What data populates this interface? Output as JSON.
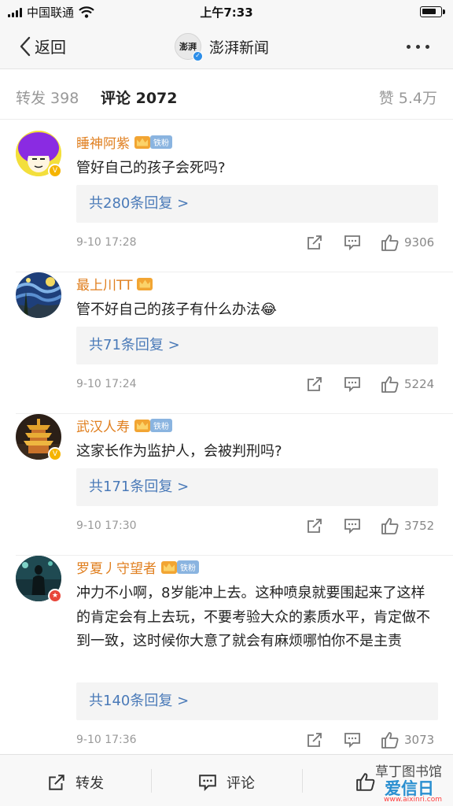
{
  "status_bar": {
    "carrier": "中国联通",
    "time": "上午7:33"
  },
  "nav": {
    "back_label": "返回",
    "account_logo_text": "澎湃",
    "account_name": "澎湃新闻"
  },
  "tabs": {
    "repost": "转发 398",
    "comment": "评论 2072",
    "likes": "赞 5.4万"
  },
  "comments": [
    {
      "user": "睡神阿紫",
      "fan_badge": "铁粉",
      "text": "管好自己的孩子会死吗?",
      "replies": "共280条回复 >",
      "date": "9-10 17:28",
      "likes": "9306",
      "avatar": "cartoon-purple-hair",
      "verified_color": "#f5b400"
    },
    {
      "user": "最上川TT",
      "fan_badge": "",
      "text": "管不好自己的孩子有什么办法😂",
      "replies": "共71条回复 >",
      "date": "9-10 17:24",
      "likes": "5224",
      "avatar": "starry-night",
      "verified_color": ""
    },
    {
      "user": "武汉人寿",
      "fan_badge": "铁粉",
      "text": "这家长作为监护人，会被判刑吗?",
      "replies": "共171条回复 >",
      "date": "9-10 17:30",
      "likes": "3752",
      "avatar": "yellow-crane-tower",
      "verified_color": "#f5b400"
    },
    {
      "user": "罗夏丿守望者",
      "fan_badge": "铁粉",
      "text": "冲力不小啊，8岁能冲上去。这种喷泉就要围起来了这样的肯定会有上去玩，不要考验大众的素质水平，肯定做不到一致，这时候你大意了就会有麻烦哪怕你不是主责",
      "replies": "共140条回复 >",
      "date": "9-10 17:36",
      "likes": "3073",
      "avatar": "rainy-street-figure",
      "verified_color": "#e8463a"
    }
  ],
  "bottom_bar": {
    "repost": "转发",
    "comment": "评论"
  },
  "watermark": {
    "line1": "草丁图书馆",
    "line2": "爱信日",
    "line3": "www.aixinri.com"
  },
  "colors": {
    "username": "#e07f1f",
    "reply_link": "#4a7ab8",
    "fan_badge_bg": "#8ab4e0"
  }
}
